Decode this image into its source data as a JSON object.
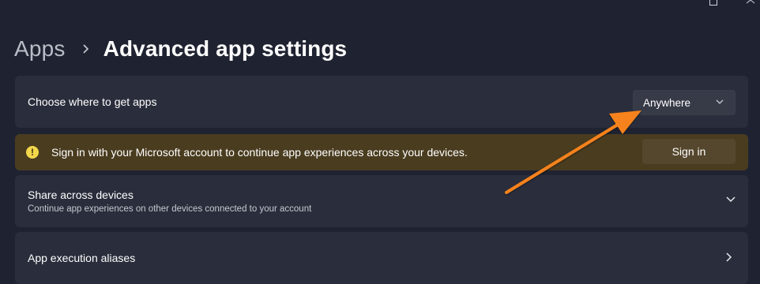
{
  "breadcrumb": {
    "parent": "Apps",
    "current": "Advanced app settings"
  },
  "settings": {
    "choose_apps": {
      "label": "Choose where to get apps",
      "dropdown_value": "Anywhere"
    },
    "signin_banner": {
      "message": "Sign in with your Microsoft account to continue app experiences across your devices.",
      "button_label": "Sign in",
      "icon": "warning-icon"
    },
    "share_devices": {
      "title": "Share across devices",
      "description": "Continue app experiences on other devices connected to your account"
    },
    "execution_aliases": {
      "label": "App execution aliases"
    }
  },
  "colors": {
    "background": "#1f2331",
    "card": "#2a2e3c",
    "banner": "#4a3c1f",
    "annotation_arrow": "#f5821f"
  }
}
